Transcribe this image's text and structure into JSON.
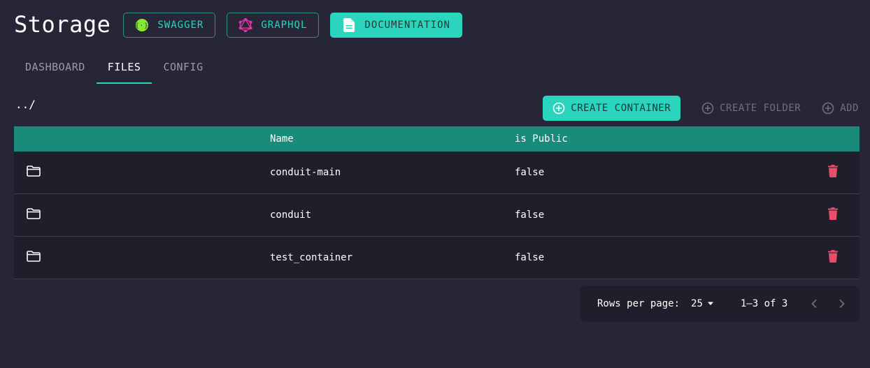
{
  "header": {
    "title": "Storage",
    "buttons": {
      "swagger": "SWAGGER",
      "graphql": "GRAPHQL",
      "documentation": "DOCUMENTATION"
    }
  },
  "tabs": [
    {
      "label": "DASHBOARD",
      "active": false
    },
    {
      "label": "FILES",
      "active": true
    },
    {
      "label": "CONFIG",
      "active": false
    }
  ],
  "path": "../",
  "actions": {
    "create_container": "CREATE CONTAINER",
    "create_folder": "CREATE FOLDER",
    "add": "ADD"
  },
  "table": {
    "columns": {
      "name": "Name",
      "is_public": "is Public"
    },
    "rows": [
      {
        "icon": "folder-icon",
        "name": "conduit-main",
        "is_public": "false"
      },
      {
        "icon": "folder-icon",
        "name": "conduit",
        "is_public": "false"
      },
      {
        "icon": "folder-icon",
        "name": "test_container",
        "is_public": "false"
      }
    ]
  },
  "pagination": {
    "rows_per_page_label": "Rows per page:",
    "rows_per_page_value": "25",
    "range": "1–3 of 3"
  },
  "colors": {
    "accent": "#2bd4bd",
    "table_header": "#1a8a7b",
    "background": "#262637",
    "delete": "#e84d6a",
    "graphql": "#e535ab",
    "swagger": "#85ea2d"
  }
}
